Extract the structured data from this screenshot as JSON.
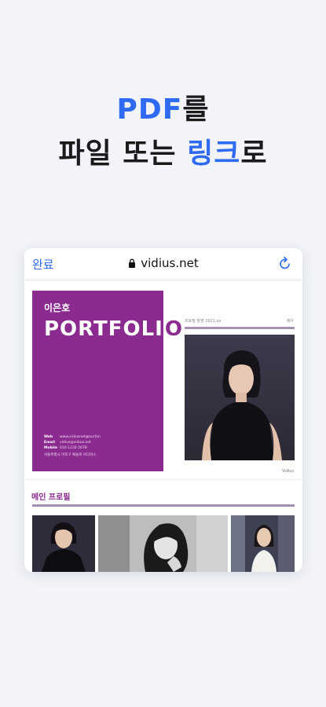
{
  "headline": {
    "line1_accent": "PDF",
    "line1_rest": "를",
    "line2_prefix": "파일 또는 ",
    "line2_accent": "링크",
    "line2_suffix": "로"
  },
  "browser": {
    "done_label": "완료",
    "url": "vidius.net",
    "lock_icon": "lock-icon",
    "reload_icon": "reload-icon"
  },
  "portfolio": {
    "name": "이은호",
    "title": "PORTFOLI",
    "title_tail": "O",
    "info": {
      "web_label": "Web",
      "web_value": "www.vidiusnet@ourfan",
      "email_label": "Email",
      "email_value": "vidius@vidius.net",
      "mobile_label": "Mobile",
      "mobile_value": "010-1234-5678",
      "note": "서울특별시 마포구 예술로 비디어스"
    },
    "page_header_left": "프로필 촬영 2021.xx",
    "page_header_right": "배우",
    "photo_caption": "Vidius",
    "section_title": "메인 프로필"
  },
  "colors": {
    "accent_blue": "#2f6bf2",
    "portfolio_purple": "#8b2a8f",
    "rule_lavender": "#a68fb3",
    "background": "#f2f4f9"
  }
}
